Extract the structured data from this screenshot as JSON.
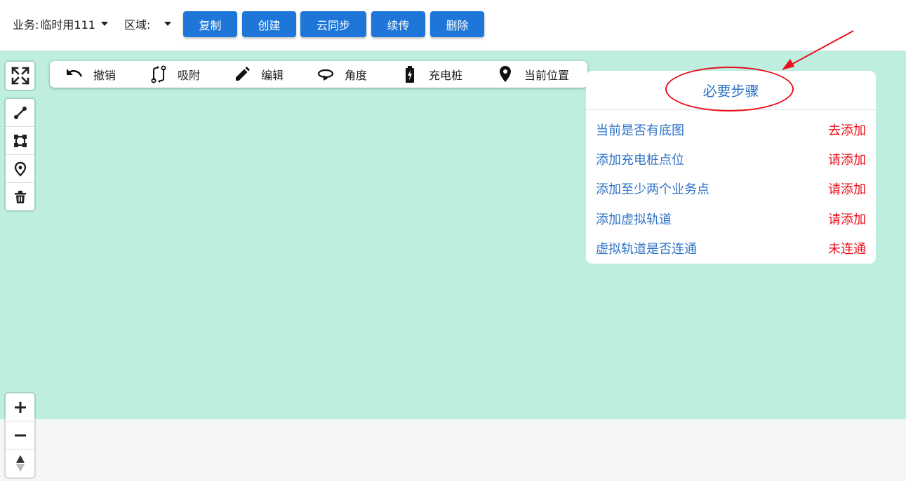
{
  "topbar": {
    "business_label": "业务:",
    "business_value": "临时用111",
    "region_label": "区域:",
    "region_value": "",
    "buttons": {
      "copy": "复制",
      "create": "创建",
      "cloud_sync": "云同步",
      "resume_upload": "续传",
      "delete": "删除"
    },
    "button_color": "#1d76d8"
  },
  "toolbar": {
    "undo": "撤销",
    "snap": "吸附",
    "edit": "编辑",
    "angle": "角度",
    "charging_pile": "充电桩",
    "current_position": "当前位置"
  },
  "left_controls": {
    "fullscreen_icon": "expand-arrows-icon",
    "draw_icons": [
      "line-icon",
      "polygon-icon",
      "marker-icon",
      "trash-icon"
    ],
    "zoom_icons": [
      "plus-icon",
      "minus-icon",
      "compass-icon"
    ]
  },
  "steps_panel": {
    "title": "必要步骤",
    "rows": [
      {
        "label": "当前是否有底图",
        "status": "去添加"
      },
      {
        "label": "添加充电桩点位",
        "status": "请添加"
      },
      {
        "label": "添加至少两个业务点",
        "status": "请添加"
      },
      {
        "label": "添加虚拟轨道",
        "status": "请添加"
      },
      {
        "label": "虚拟轨道是否连通",
        "status": "未连通"
      }
    ],
    "label_color": "#2d73c5",
    "status_color": "#e8111b"
  },
  "map": {
    "background": "#bdeedf"
  }
}
